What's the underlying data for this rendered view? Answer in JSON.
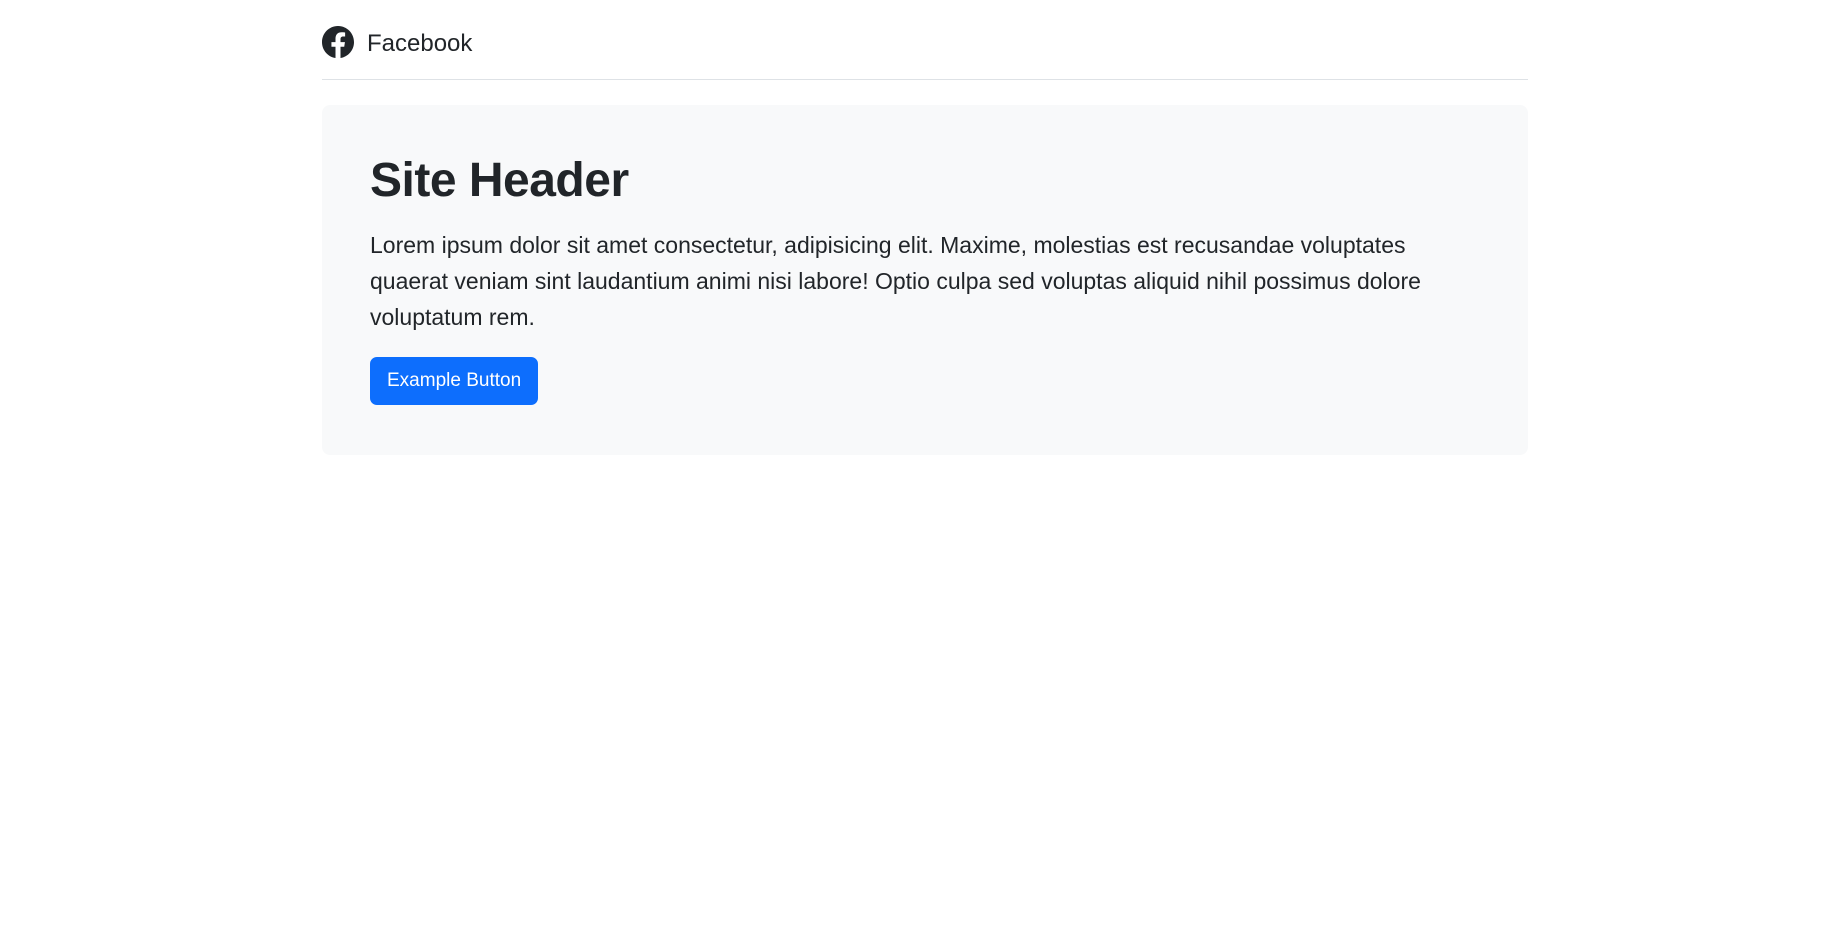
{
  "header": {
    "brand_label": "Facebook",
    "brand_icon": "facebook-icon"
  },
  "hero": {
    "title": "Site Header",
    "body": "Lorem ipsum dolor sit amet consectetur, adipisicing elit. Maxime, molestias est recusandae voluptates quaerat veniam sint laudantium animi nisi labore! Optio culpa sed voluptas aliquid nihil possimus dolore voluptatum rem.",
    "button_label": "Example Button"
  },
  "colors": {
    "primary": "#0d6efd",
    "hero_bg": "#f8f9fa",
    "text": "#212529",
    "divider": "#dee2e6"
  }
}
